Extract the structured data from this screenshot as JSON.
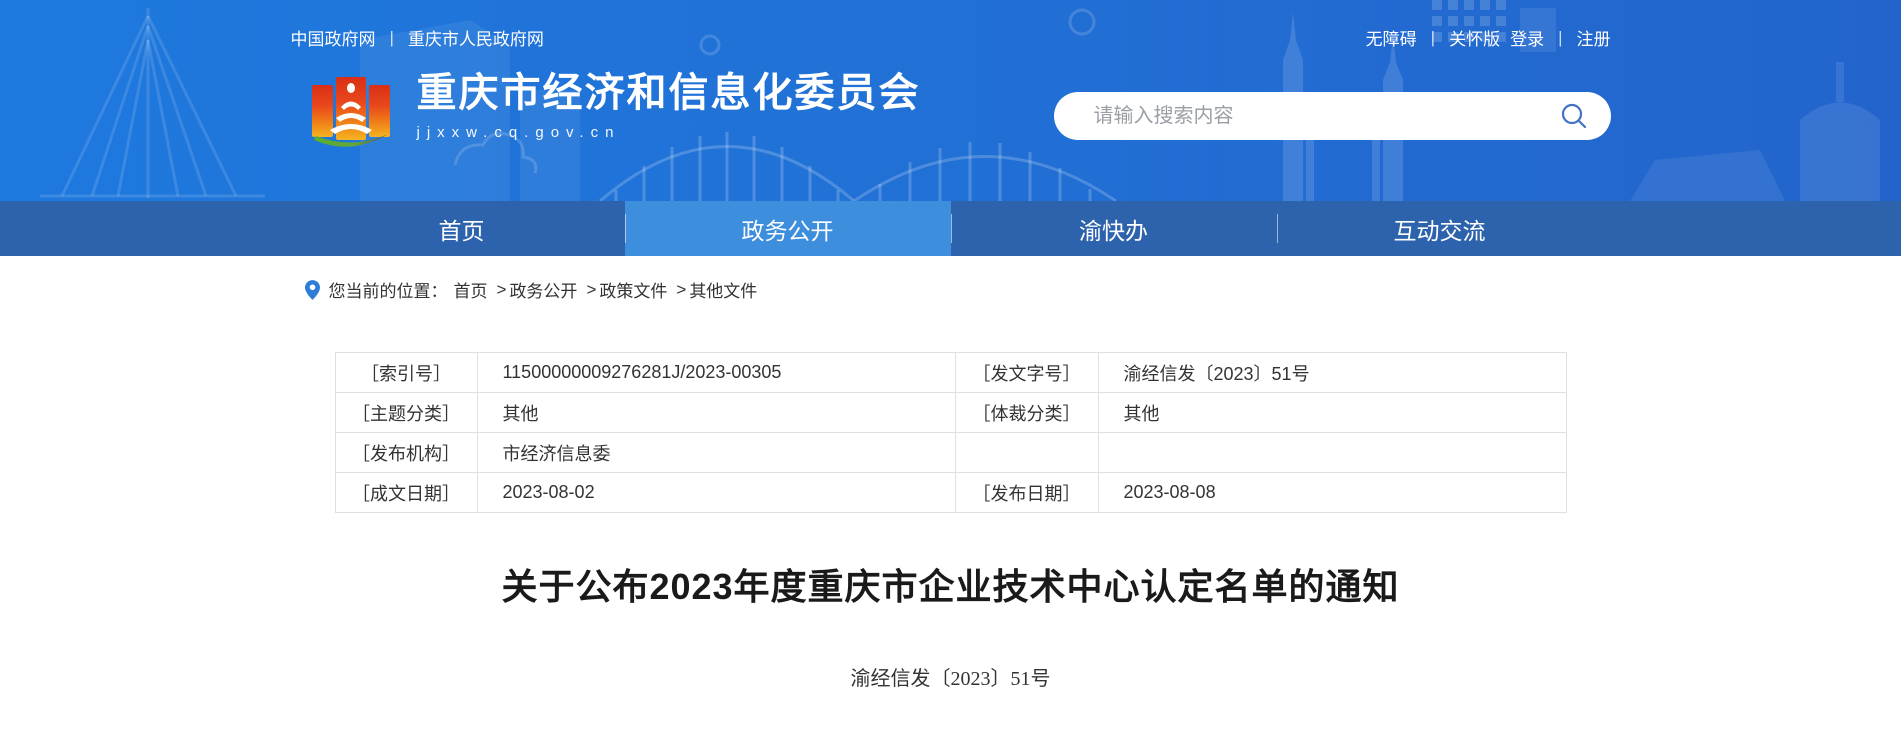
{
  "top_bar": {
    "left_links": [
      "中国政府网",
      "重庆市人民政府网"
    ],
    "right_links": [
      "无障碍",
      "关怀版",
      "登录",
      "注册"
    ]
  },
  "brand": {
    "site_name": "重庆市经济和信息化委员会",
    "site_url": "jjxxw.cq.gov.cn"
  },
  "search": {
    "placeholder": "请输入搜索内容",
    "icon": "search-icon"
  },
  "nav": {
    "items": [
      {
        "label": "首页",
        "active": false
      },
      {
        "label": "政务公开",
        "active": true
      },
      {
        "label": "渝快办",
        "active": false
      },
      {
        "label": "互动交流",
        "active": false
      }
    ]
  },
  "breadcrumb": {
    "prefix": "您当前的位置：",
    "separator": ">",
    "items": [
      "首页",
      "政务公开",
      "政策文件",
      "其他文件"
    ]
  },
  "meta_table": {
    "rows": [
      {
        "label1": "［索引号］",
        "value1": "11500000009276281J/2023-00305",
        "label2": "［发文字号］",
        "value2": "渝经信发〔2023〕51号"
      },
      {
        "label1": "［主题分类］",
        "value1": "其他",
        "label2": "［体裁分类］",
        "value2": "其他"
      },
      {
        "label1": "［发布机构］",
        "value1": "市经济信息委",
        "label2": "",
        "value2": ""
      },
      {
        "label1": "［成文日期］",
        "value1": "2023-08-02",
        "label2": "［发布日期］",
        "value2": "2023-08-08"
      }
    ]
  },
  "article": {
    "title": "关于公布2023年度重庆市企业技术中心认定名单的通知",
    "doc_number": "渝经信发〔2023〕51号"
  },
  "colors": {
    "header_gradient_start": "#1e79de",
    "header_gradient_end": "#2264cc",
    "nav_blue": "#2d63ad",
    "nav_active_blue": "#3e8ede",
    "logo_red": "#e0341b",
    "logo_orange": "#f5a81f",
    "logo_green": "#55b02d",
    "search_icon_blue": "#4272c4",
    "table_border": "#e0e0e0",
    "text_dark": "#333333"
  }
}
